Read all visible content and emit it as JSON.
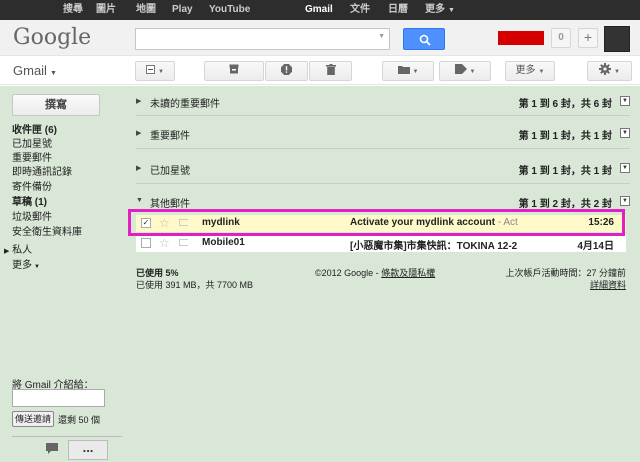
{
  "topbar": {
    "items": [
      "搜尋",
      "圖片",
      "地圖",
      "Play",
      "YouTube",
      "Gmail",
      "文件",
      "日曆",
      "更多"
    ],
    "active": "Gmail"
  },
  "header": {
    "logo": "Google",
    "search_placeholder": "",
    "notifications_count": "0",
    "share_label": "+"
  },
  "appbar": {
    "title": "Gmail",
    "more_label": "更多"
  },
  "sidebar": {
    "compose": "撰寫",
    "items": [
      {
        "label": "收件匣 (6)",
        "bold": true
      },
      {
        "label": "已加星號",
        "bold": false
      },
      {
        "label": "重要郵件",
        "bold": false
      },
      {
        "label": "即時通訊記錄",
        "bold": false
      },
      {
        "label": "寄件備份",
        "bold": false
      },
      {
        "label": "草稿 (1)",
        "bold": true
      },
      {
        "label": "垃圾郵件",
        "bold": false
      },
      {
        "label": "安全衛生資料庫",
        "bold": false
      }
    ],
    "people": "私人",
    "more": "更多",
    "invite_label": "將 Gmail 介紹給：",
    "invite_button": "傳送邀請",
    "invites_left": "還剩 50 個"
  },
  "sections": [
    {
      "title": "未讀的重要郵件",
      "count": "第 1 到 6 封，共 6 封"
    },
    {
      "title": "重要郵件",
      "count": "第 1 到 1 封，共 1 封"
    },
    {
      "title": "已加星號",
      "count": "第 1 到 1 封，共 1 封"
    },
    {
      "title": "其他郵件",
      "count": "第 1 到 2 封，共 2 封"
    }
  ],
  "emails": [
    {
      "sender": "mydlink",
      "subject": "Activate your mydlink account",
      "snippet": " - Act",
      "date": "15:26",
      "checked": true
    },
    {
      "sender": "Mobile01",
      "subject": "[小惡魔市集]市集快訊：TOKINA 12-2",
      "snippet": "",
      "date": "4月14日",
      "checked": false
    }
  ],
  "footer": {
    "usage_pct": "已使用 5%",
    "usage_detail": "已使用 391 MB，共 7700 MB",
    "copyright": "©2012 Google - ",
    "terms": "條款及隱私權",
    "last_activity": "上次帳戶活動時間：27 分鐘前",
    "details": "詳細資料"
  },
  "colors": {
    "highlight": "#e020c0",
    "search_button": "#4d90fe",
    "redaction": "#d40000",
    "background": "#d8e7d6"
  }
}
